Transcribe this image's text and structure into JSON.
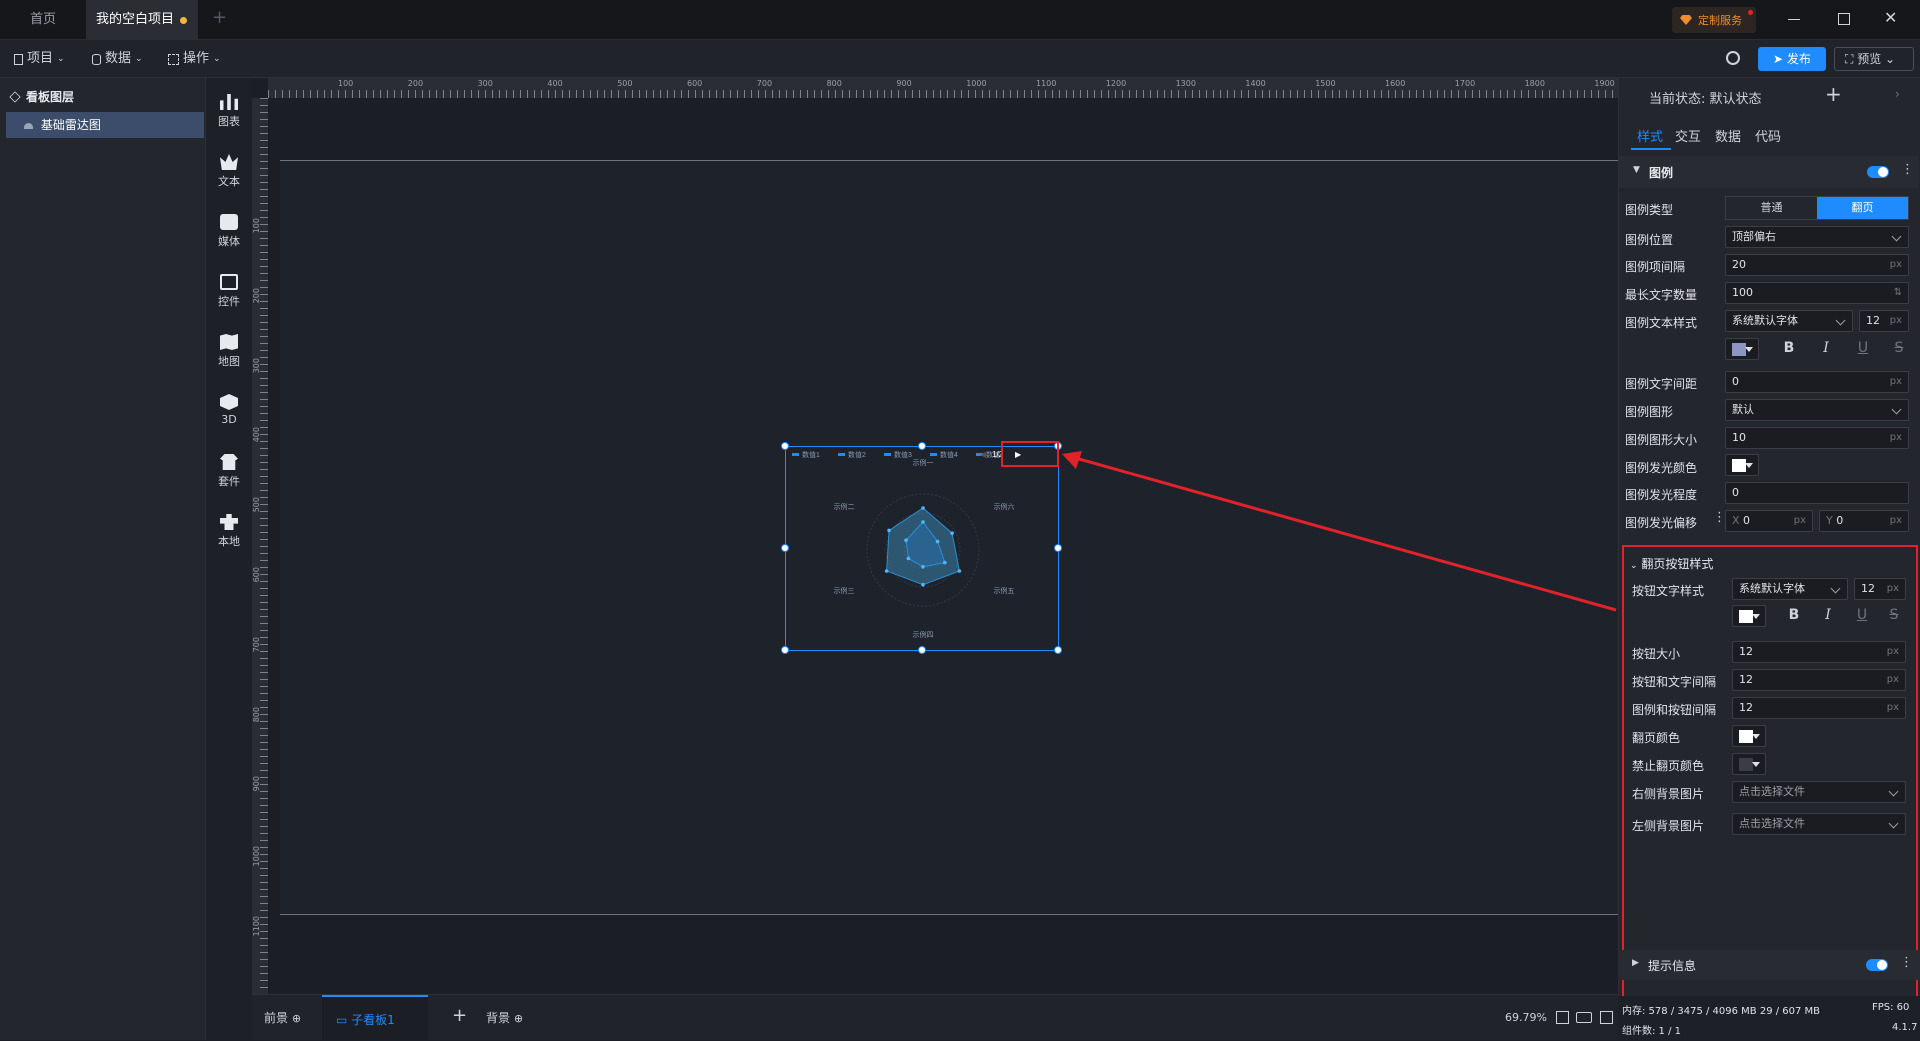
{
  "tabs": {
    "home": "首页",
    "project": "我的空白项目"
  },
  "titlebar": {
    "custom_service": "定制服务"
  },
  "menu": {
    "project": "项目",
    "data": "数据",
    "operate": "操作",
    "publish": "发布",
    "preview": "预览"
  },
  "layers": {
    "title": "看板图层",
    "item": "基础雷达图"
  },
  "toolbox": [
    "图表",
    "文本",
    "媒体",
    "控件",
    "地图",
    "3D",
    "套件",
    "本地"
  ],
  "ruler": {
    "top": [
      "100",
      "200",
      "300",
      "400",
      "500",
      "600",
      "700",
      "800",
      "900",
      "1000",
      "1100",
      "1200",
      "1300",
      "1400",
      "1500",
      "1600",
      "1700",
      "1800",
      "1900"
    ],
    "left": [
      "100",
      "200",
      "300",
      "400",
      "500",
      "600",
      "700",
      "800",
      "900",
      "1000",
      "1100"
    ]
  },
  "chart": {
    "legend": [
      "数值1",
      "数值2",
      "数值3",
      "数值4",
      "数值"
    ],
    "page": "1/2",
    "indicators": [
      "示例一",
      "示例二",
      "示例三",
      "示例四",
      "示例五",
      "示例六"
    ]
  },
  "bottom": {
    "front": "前景",
    "sub": "子看板1",
    "bg": "背景",
    "zoom": "69.79%"
  },
  "panel": {
    "state": "当前状态:  默认状态",
    "tabs": [
      "样式",
      "交互",
      "数据",
      "代码"
    ],
    "legend_section": "图例",
    "type_label": "图例类型",
    "type_opt1": "普通",
    "type_opt2": "翻页",
    "pos_label": "图例位置",
    "pos_value": "顶部偏右",
    "gap_label": "图例项间隔",
    "gap_value": "20",
    "maxlen_label": "最长文字数量",
    "maxlen_value": "100",
    "textstyle_label": "图例文本样式",
    "font_value": "系统默认字体",
    "font_size": "12",
    "letter_label": "图例文字间距",
    "letter_value": "0",
    "shape_label": "图例图形",
    "shape_value": "默认",
    "shape_size_label": "图例图形大小",
    "shape_size_value": "10",
    "glow_color_label": "图例发光颜色",
    "glow_level_label": "图例发光程度",
    "glow_level_value": "0",
    "glow_offset_label": "图例发光偏移",
    "glow_x": "0",
    "glow_y": "0",
    "page_section": "翻页按钮样式",
    "btn_text_label": "按钮文字样式",
    "btn_font": "系统默认字体",
    "btn_font_size": "12",
    "btn_size_label": "按钮大小",
    "btn_size_value": "12",
    "btn_gap_label": "按钮和文字间隔",
    "btn_gap_value": "12",
    "legend_btn_gap_label": "图例和按钮间隔",
    "legend_btn_gap_value": "12",
    "page_color_label": "翻页颜色",
    "disabled_color_label": "禁止翻页颜色",
    "right_bg_label": "右侧背景图片",
    "left_bg_label": "左侧背景图片",
    "choose_file": "点击选择文件",
    "tooltip_section": "提示信息",
    "unit": "px",
    "bold": "B",
    "italic": "I",
    "underline": "U",
    "strike": "S",
    "x": "X",
    "y": "Y"
  },
  "status": {
    "mem": "内存:  578 / 3475 / 4096 MB  29 / 607 MB",
    "fps": "FPS:  60",
    "count": "组件数: 1 / 1",
    "version": "4.1.7"
  },
  "colors": {
    "accent": "#1e8cff",
    "highlight": "#e2222a"
  }
}
